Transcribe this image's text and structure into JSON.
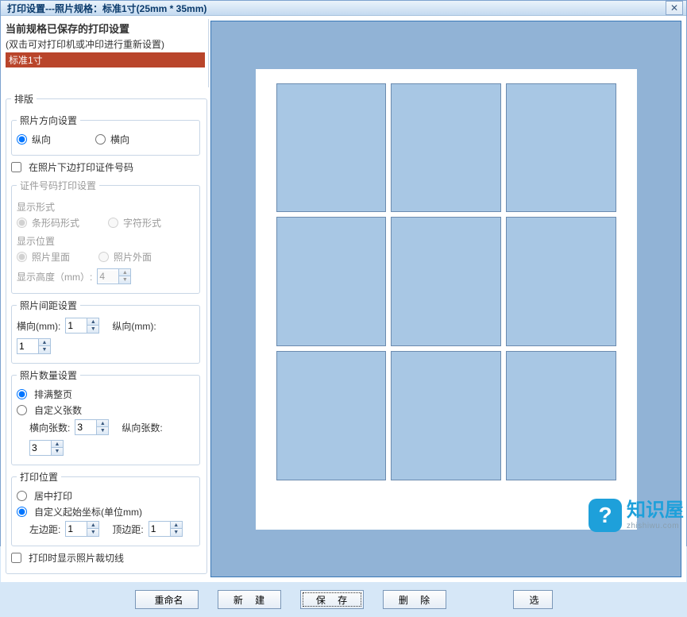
{
  "title": "打印设置---照片规格：标准1寸(25mm * 35mm)",
  "savedHeader": "当前规格已保存的打印设置",
  "savedHint": "(双击可对打印机或冲印进行重新设置)",
  "savedList": {
    "selected": "标准1寸"
  },
  "layout": {
    "legend": "排版",
    "orientation": {
      "legend": "照片方向设置",
      "portrait": "纵向",
      "landscape": "横向",
      "selected": "portrait"
    },
    "printCode": {
      "checkbox": "在照片下边打印证件号码",
      "legend": "证件号码打印设置",
      "displayForm": {
        "legend": "显示形式",
        "barcode": "条形码形式",
        "text": "字符形式"
      },
      "displayPos": {
        "legend": "显示位置",
        "inside": "照片里面",
        "outside": "照片外面"
      },
      "heightLabel": "显示高度（mm）:",
      "heightValue": "4"
    },
    "spacing": {
      "legend": "照片间距设置",
      "hLabel": "横向(mm):",
      "hValue": "1",
      "vLabel": "纵向(mm):",
      "vValue": "1"
    },
    "count": {
      "legend": "照片数量设置",
      "full": "排满整页",
      "custom": "自定义张数",
      "hLabel": "横向张数:",
      "hValue": "3",
      "vLabel": "纵向张数:",
      "vValue": "3",
      "selected": "full"
    },
    "position": {
      "legend": "打印位置",
      "center": "居中打印",
      "custom": "自定义起始坐标(单位mm)",
      "leftLabel": "左边距:",
      "leftValue": "1",
      "topLabel": "顶边距:",
      "topValue": "1",
      "selected": "custom"
    },
    "cropLines": "打印时显示照片裁切线"
  },
  "buttons": {
    "rename": "重命名",
    "new": "新  建",
    "save": "保  存",
    "delete": "删  除",
    "select": "选"
  },
  "watermark": {
    "q": "?",
    "cn": "知识屋",
    "py": "zhishiwu.com"
  }
}
